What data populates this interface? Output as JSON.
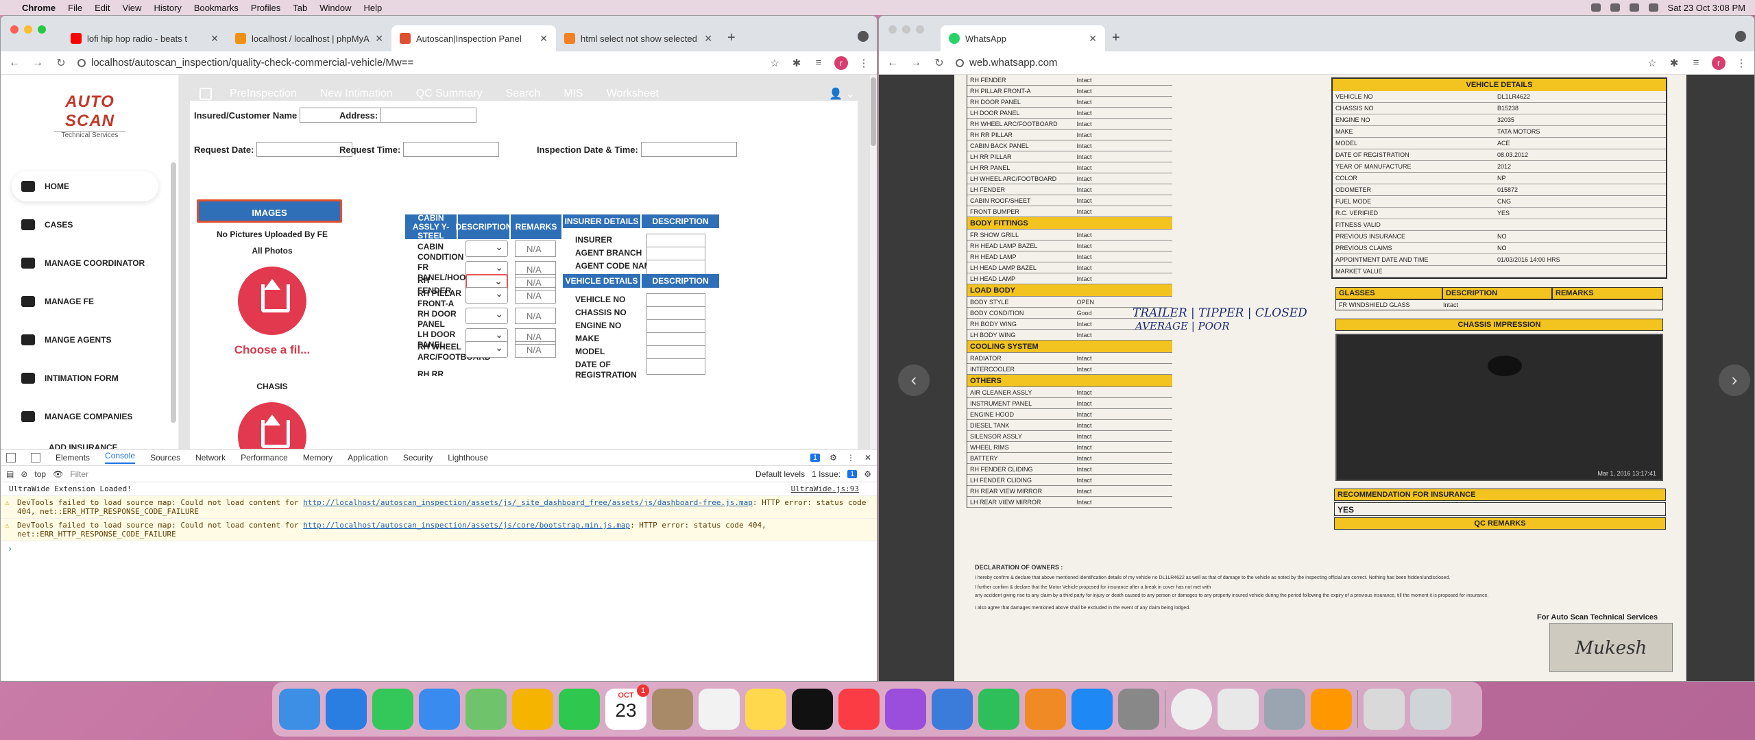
{
  "menubar": {
    "app": "Chrome",
    "items": [
      "File",
      "Edit",
      "View",
      "History",
      "Bookmarks",
      "Profiles",
      "Tab",
      "Window",
      "Help"
    ],
    "clock": "Sat 23 Oct  3:08 PM"
  },
  "left": {
    "tabs": [
      {
        "label": "lofi hip hop radio - beats t",
        "color": "#ff0000"
      },
      {
        "label": "localhost / localhost | phpMyA",
        "color": "#f29111"
      },
      {
        "label": "Autoscan|Inspection Panel",
        "color": "#e05030"
      },
      {
        "label": "html select not show selected",
        "color": "#f48024"
      }
    ],
    "url": "localhost/autoscan_inspection/quality-check-commercial-vehicle/Mw==",
    "logo": {
      "brand": "AUTO SCAN",
      "tag": "Technical Services"
    },
    "nav": [
      "HOME",
      "CASES",
      "MANAGE COORDINATOR",
      "MANAGE FE",
      "MANGE AGENTS",
      "INTIMATION FORM",
      "MANAGE COMPANIES",
      "ADD INSURANCE"
    ],
    "topnav": [
      "PreInspection",
      "New Intimation",
      "QC Summary",
      "Search",
      "MIS",
      "Worksheet"
    ],
    "form": {
      "insured": "Insured/Customer Name",
      "address": "Address:",
      "req_date": "Request Date:",
      "req_time": "Request Time:",
      "insp_dt": "Inspection Date & Time:"
    },
    "images": {
      "header": "IMAGES",
      "no_pics": "No Pictures Uploaded By FE",
      "all_photos": "All Photos",
      "choose": "Choose a fil...",
      "chasis": "CHASIS"
    },
    "cabin": {
      "headers": [
        "CABIN ASSLY Y-STEEL",
        "DESCRIPTION",
        "REMARKS"
      ],
      "rows": [
        "CABIN CONDITION",
        "FR PANEL/HOOD",
        "RH FENDER",
        "RH PILLAR FRONT-A",
        "RH DOOR PANEL",
        "LH DOOR PANEL",
        "RH WHEEL ARC/FOOTBOARD",
        "RH RR PILLAR"
      ],
      "remark": "N/A"
    },
    "insurer": {
      "headers": [
        "INSURER DETAILS",
        "DESCRIPTION"
      ],
      "rows": [
        "INSURER",
        "AGENT BRANCH",
        "AGENT CODE NAME"
      ]
    },
    "vehicle": {
      "headers": [
        "VEHICLE DETAILS",
        "DESCRIPTION"
      ],
      "rows": [
        "VEHICLE NO",
        "CHASSIS NO",
        "ENGINE NO",
        "MAKE",
        "MODEL",
        "DATE OF REGISTRATION"
      ]
    },
    "devtools": {
      "tabs": [
        "Elements",
        "Console",
        "Sources",
        "Network",
        "Performance",
        "Memory",
        "Application",
        "Security",
        "Lighthouse"
      ],
      "context": "top",
      "filter": "Filter",
      "levels": "Default levels",
      "issue": "1 Issue:",
      "count": "1",
      "log1": "UltraWide Extension Loaded!",
      "log1src": "UltraWide.js:93",
      "w1a": "DevTools failed to load source map: Could not load content for ",
      "w1link": "http://localhost/autoscan_inspection/assets/js/_site_dashboard_free/assets/js/dashboard-free.js.map",
      "w1b": ": HTTP error: status code 404, net::ERR_HTTP_RESPONSE_CODE_FAILURE",
      "w2a": "DevTools failed to load source map: Could not load content for ",
      "w2link": "http://localhost/autoscan_inspection/assets/js/core/bootstrap.min.js.map",
      "w2b": ": HTTP error: status code 404, net::ERR_HTTP_RESPONSE_CODE_FAILURE"
    }
  },
  "right": {
    "tab": "WhatsApp",
    "url": "web.whatsapp.com",
    "doc": {
      "left_rows": [
        "RH FENDER",
        "RH PILLAR FRONT-A",
        "RH DOOR PANEL",
        "LH DOOR PANEL",
        "RH WHEEL ARC/FOOTBOARD",
        "RH RR PILLAR",
        "CABIN BACK PANEL",
        "LH RR PILLAR",
        "LH RR PANEL",
        "LH WHEEL ARC/FOOTBOARD",
        "LH FENDER",
        "CABIN ROOF/SHEET",
        "FRONT BUMPER"
      ],
      "body_hdr": "BODY FITTINGS",
      "body_rows": [
        "FR SHOW GRILL",
        "RH HEAD LAMP BAZEL",
        "RH HEAD LAMP",
        "LH HEAD LAMP BAZEL",
        "LH HEAD LAMP"
      ],
      "load_hdr": "LOAD BODY",
      "load_rows": [
        [
          "BODY STYLE",
          "OPEN"
        ],
        [
          "BODY CONDITION",
          "Good"
        ],
        [
          "RH BODY WING",
          "Intact"
        ],
        [
          "LH BODY WING",
          "Intact"
        ]
      ],
      "cool_hdr": "COOLING SYSTEM",
      "cool_rows": [
        "RADIATOR",
        "INTERCOOLER"
      ],
      "oth_hdr": "OTHERS",
      "oth_rows": [
        "AIR CLEANER ASSLY",
        "INSTRUMENT PANEL",
        "ENGINE HOOD",
        "DIESEL TANK",
        "SILENSOR ASSLY",
        "WHEEL RIMS",
        "BATTERY",
        "RH FENDER CLIDING",
        "LH FENDER CLIDING",
        "RH REAR VIEW MIRROR",
        "LH REAR VIEW MIRROR"
      ],
      "intact": "Intact",
      "veh_hdr": "VEHICLE DETAILS",
      "veh_rows": [
        [
          "VEHICLE NO",
          "DL1LR4622"
        ],
        [
          "CHASSIS NO",
          "B15238"
        ],
        [
          "ENGINE NO",
          "32035"
        ],
        [
          "MAKE",
          "TATA MOTORS"
        ],
        [
          "MODEL",
          "ACE"
        ],
        [
          "DATE OF REGISTRATION",
          "08.03.2012"
        ],
        [
          "YEAR OF MANUFACTURE",
          "2012"
        ],
        [
          "COLOR",
          "NP"
        ],
        [
          "ODOMETER",
          "015872"
        ],
        [
          "FUEL MODE",
          "CNG"
        ],
        [
          "R.C. VERIFIED",
          "YES"
        ],
        [
          "FITNESS VALID",
          ""
        ],
        [
          "PREVIOUS INSURANCE",
          "NO"
        ],
        [
          "PREVIOUS CLAIMS",
          "NO"
        ],
        [
          "APPOINTMENT DATE AND TIME",
          "01/03/2016 14:00 HRS"
        ],
        [
          "MARKET VALUE",
          ""
        ]
      ],
      "glass_hdrs": [
        "GLASSES",
        "DESCRIPTION",
        "REMARKS"
      ],
      "glass_row": [
        "FR WINDSHIELD GLASS",
        "Intact"
      ],
      "chassis_imp": "CHASSIS IMPRESSION",
      "photo_ts": "Mar 1, 2016 13:17:41",
      "rec": "RECOMMENDATION FOR INSURANCE",
      "rec_val": "YES",
      "qc": "QC REMARKS",
      "hand1": "TRAILER | TIPPER | CLOSED",
      "hand2": "AVERAGE | POOR",
      "decl_hdr": "DECLARATION OF OWNERS :",
      "decl1": "I hereby confirm & declare that above mentioned identification details of my vehicle no DL1LR4622 as well as that of damage to the vehicle as noted by the inspecting official are correct. Nothing has been hidden/undisclosed.",
      "decl2": "I further confirm & declare that the Motor Vehicle proposed for insurance after a break in cover has not met with",
      "decl3": "any accident giving rise to any claim by a third party for injury or death caused to any person or damages to any property insured vehicle during the period following the expiry of a previous insurance, till the moment it is proposed for insurance.",
      "decl4": "I also agree that damages mentioned above shall be excluded in the event of any claim being lodged.",
      "for": "For Auto Scan Technical Services",
      "sig": "Mukesh"
    }
  },
  "dock": {
    "cal_month": "OCT",
    "cal_day": "23",
    "badge": "1"
  }
}
